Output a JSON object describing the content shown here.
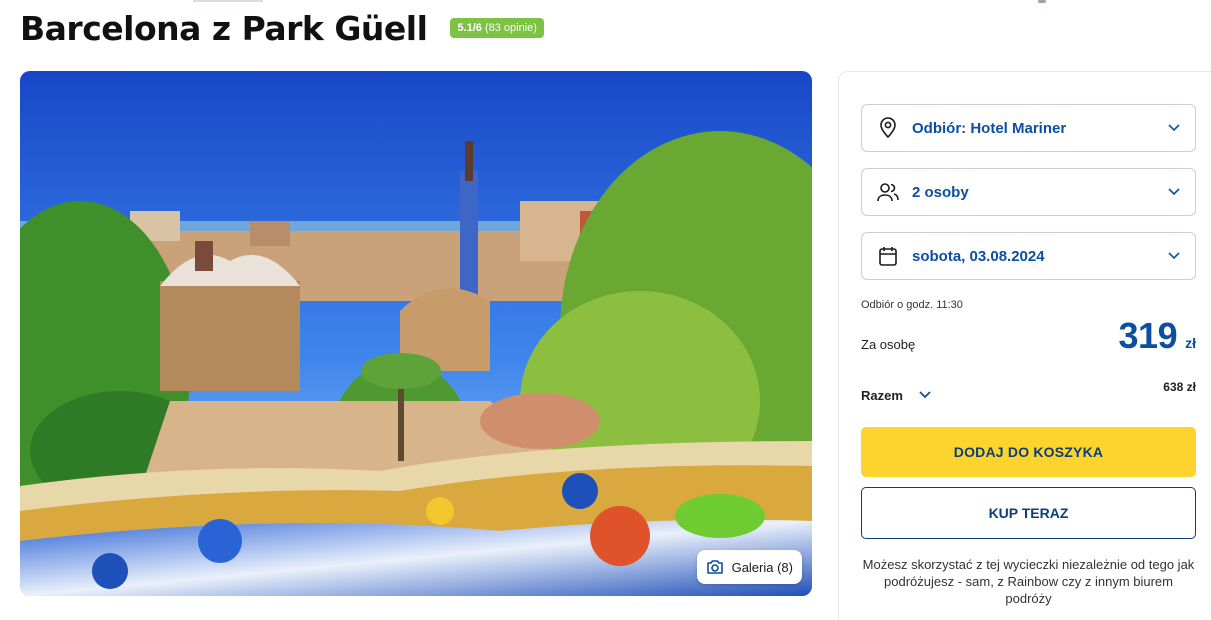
{
  "header": {
    "title": "Barcelona z Park Güell",
    "rating": "5.1/6",
    "reviews": "(83 opinie)"
  },
  "hero": {
    "gallery_label": "Galeria (8)",
    "gallery_icon": "camera-icon"
  },
  "booking": {
    "pickup": {
      "label": "Odbiór: Hotel Mariner",
      "icon": "location-pin-icon"
    },
    "persons": {
      "label": "2 osoby",
      "icon": "users-icon"
    },
    "date": {
      "label": "sobota, 03.08.2024",
      "icon": "calendar-icon"
    },
    "pickup_time": "Odbiór o godz. 11:30",
    "per_person_label": "Za osobę",
    "price": "319",
    "currency": "zł",
    "total_label": "Razem",
    "total_amount": "638 zł",
    "add_to_cart": "DODAJ DO KOSZYKA",
    "buy_now": "KUP TERAZ",
    "note": "Możesz skorzystać z tej wycieczki niezależnie od tego jak podróżujesz - sam, z Rainbow czy z innym biurem podróży"
  },
  "colors": {
    "accent_blue": "#0b4fa0",
    "cart_yellow": "#fcd42d",
    "rating_green": "#7dc242"
  }
}
